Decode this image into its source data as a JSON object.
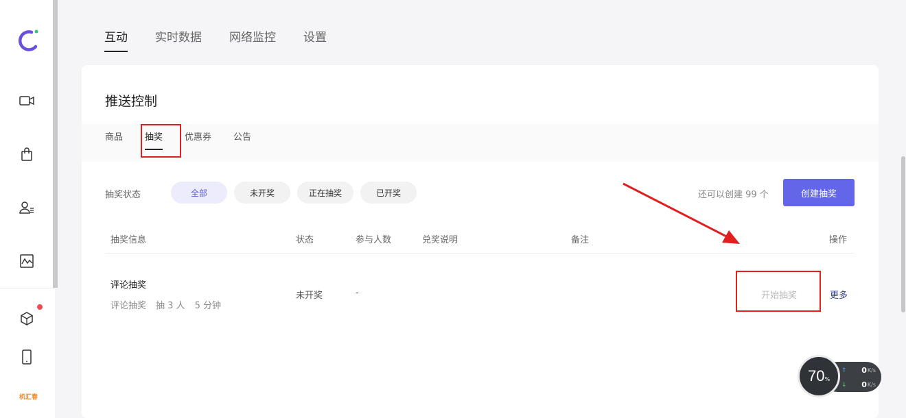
{
  "top_tabs": [
    {
      "label": "互动"
    },
    {
      "label": "实时数据"
    },
    {
      "label": "网络监控"
    },
    {
      "label": "设置"
    }
  ],
  "card": {
    "title": "推送控制",
    "sub_tabs": [
      {
        "label": "商品"
      },
      {
        "label": "抽奖"
      },
      {
        "label": "优惠券"
      },
      {
        "label": "公告"
      }
    ]
  },
  "filter": {
    "label": "抽奖状态",
    "options": [
      "全部",
      "未开奖",
      "正在抽奖",
      "已开奖"
    ],
    "selected": "全部"
  },
  "quota_text": "还可以创建 99 个",
  "create_button": "创建抽奖",
  "table": {
    "headers": {
      "info": "抽奖信息",
      "status": "状态",
      "participants": "参与人数",
      "redeem": "兑奖说明",
      "remark": "备注",
      "action": "操作"
    },
    "rows": [
      {
        "title": "评论抽奖",
        "type": "评论抽奖",
        "winners": "抽 3 人",
        "duration": "5 分钟",
        "status": "未开奖",
        "participants": "-",
        "start_action": "开始抽奖",
        "more_action": "更多"
      }
    ]
  },
  "sidebar": {
    "icons": [
      "logo-icon",
      "video-camera-icon",
      "shopping-bag-icon",
      "user-list-icon",
      "chart-icon",
      "cube-icon",
      "tablet-icon"
    ],
    "brand_text": "机汇春"
  },
  "speed_widget": {
    "percent": "70",
    "percent_sign": "%",
    "upload": "0",
    "download": "0",
    "unit": "K/s"
  },
  "colors": {
    "accent": "#6366e8",
    "annotation_red": "#e02020",
    "notification_dot": "#ef4b55"
  }
}
